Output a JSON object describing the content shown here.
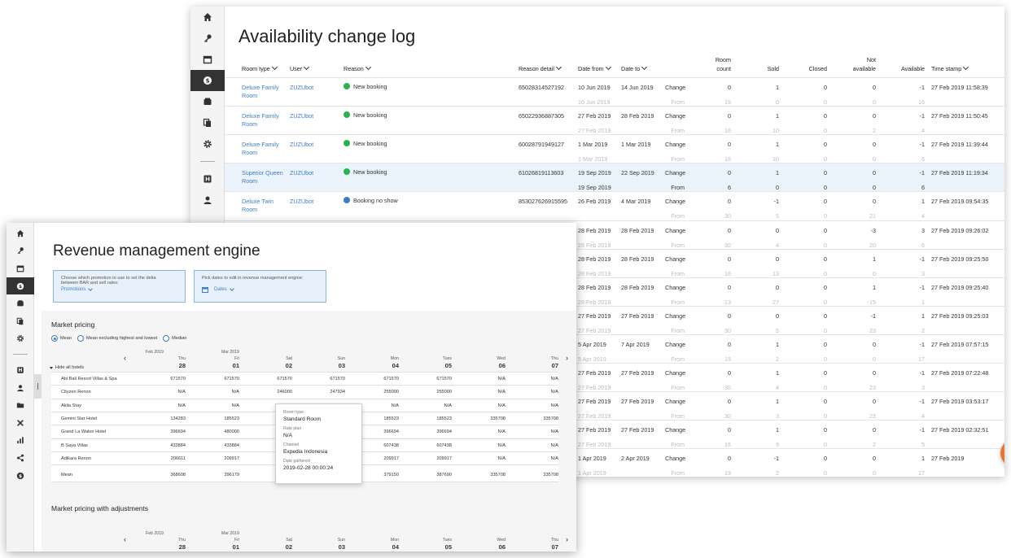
{
  "back": {
    "title": "Availability change log",
    "headers": {
      "room_type": "Room type",
      "user": "User",
      "reason": "Reason",
      "reason_detail": "Reason detail",
      "date_from": "Date from",
      "date_to": "Date to",
      "room_count_1": "Room",
      "room_count_2": "count",
      "sold": "Sold",
      "closed": "Closed",
      "not_available_1": "Not",
      "not_available_2": "available",
      "available": "Available",
      "timestamp": "Time stamp"
    },
    "colors": {
      "green": "#2ab24e",
      "blue": "#3b7ec8"
    },
    "rows": [
      {
        "room": "Deluxe Family",
        "room2": "Room",
        "user": "ZUZUbot",
        "reason": "New booking",
        "dot": "green",
        "detail": "65028314527192",
        "from": "10 Jun 2019",
        "to": "14 Jun 2019",
        "change": "Change",
        "rc": "0",
        "sold": "1",
        "closed": "0",
        "na": "0",
        "avail": "-1",
        "ts": "27 Feb 2019 11:58:39",
        "sub_from": "10 Jun 2019",
        "sub_lbl": "From",
        "s_rc": "16",
        "s_sold": "0",
        "s_closed": "0",
        "s_na": "0",
        "s_avail": "16"
      },
      {
        "room": "Deluxe Family",
        "room2": "Room",
        "user": "ZUZUbot",
        "reason": "New booking",
        "dot": "green",
        "detail": "65022936887305",
        "from": "27 Feb 2019",
        "to": "28 Feb 2019",
        "change": "Change",
        "rc": "0",
        "sold": "1",
        "closed": "0",
        "na": "0",
        "avail": "-1",
        "ts": "27 Feb 2019 11:50:45",
        "sub_from": "27 Feb 2019",
        "sub_lbl": "From",
        "s_rc": "16",
        "s_sold": "10",
        "s_closed": "0",
        "s_na": "2",
        "s_avail": "4"
      },
      {
        "room": "Deluxe Family",
        "room2": "Room",
        "user": "ZUZUbot",
        "reason": "New booking",
        "dot": "green",
        "detail": "60028791949127",
        "from": "1 Mar 2019",
        "to": "1 Mar 2019",
        "change": "Change",
        "rc": "0",
        "sold": "1",
        "closed": "0",
        "na": "0",
        "avail": "-1",
        "ts": "27 Feb 2019 11:39:44",
        "sub_from": "1 Mar 2019",
        "sub_lbl": "From",
        "s_rc": "16",
        "s_sold": "10",
        "s_closed": "0",
        "s_na": "0",
        "s_avail": "6"
      },
      {
        "room": "Superior Queen",
        "room2": "Room",
        "user": "ZUZUbot",
        "reason": "New booking",
        "dot": "green",
        "detail": "61026819113603",
        "from": "19 Sep 2019",
        "to": "22 Sep 2019",
        "change": "Change",
        "rc": "0",
        "sold": "1",
        "closed": "0",
        "na": "0",
        "avail": "-1",
        "ts": "27 Feb 2019 11:19:34",
        "sub_from": "19 Sep 2019",
        "sub_lbl": "From",
        "s_rc": "6",
        "s_sold": "0",
        "s_closed": "0",
        "s_na": "0",
        "s_avail": "6"
      },
      {
        "room": "Deluxe Twin",
        "room2": "Room",
        "user": "ZUZUbot",
        "reason": "Booking no show",
        "dot": "blue",
        "detail": "853027626915595",
        "from": "26 Feb 2019",
        "to": "4 Mar 2019",
        "change": "Change",
        "rc": "0",
        "sold": "-1",
        "closed": "0",
        "na": "0",
        "avail": "1",
        "ts": "27 Feb 2019 09:54:35",
        "sub_from": "",
        "sub_lbl": "From",
        "s_rc": "30",
        "s_sold": "5",
        "s_closed": "0",
        "s_na": "21",
        "s_avail": "4"
      },
      {
        "room": "",
        "room2": "",
        "user": "",
        "reason": "",
        "dot": "",
        "detail": "",
        "from": "28 Feb 2019",
        "to": "28 Feb 2019",
        "change": "Change",
        "rc": "0",
        "sold": "0",
        "closed": "0",
        "na": "-3",
        "avail": "3",
        "ts": "27 Feb 2019 09:26:02",
        "sub_from": "28 Feb 2019",
        "sub_lbl": "From",
        "s_rc": "30",
        "s_sold": "4",
        "s_closed": "0",
        "s_na": "20",
        "s_avail": "6"
      },
      {
        "room": "",
        "room2": "",
        "user": "",
        "reason": "",
        "dot": "",
        "detail": "",
        "from": "28 Feb 2019",
        "to": "28 Feb 2019",
        "change": "Change",
        "rc": "0",
        "sold": "0",
        "closed": "0",
        "na": "1",
        "avail": "-1",
        "ts": "27 Feb 2019 09:25:50",
        "sub_from": "28 Feb 2019",
        "sub_lbl": "From",
        "s_rc": "16",
        "s_sold": "13",
        "s_closed": "0",
        "s_na": "0",
        "s_avail": "3"
      },
      {
        "room": "",
        "room2": "",
        "user": "",
        "reason": "",
        "dot": "",
        "detail": "",
        "from": "28 Feb 2019",
        "to": "28 Feb 2019",
        "change": "Change",
        "rc": "0",
        "sold": "0",
        "closed": "0",
        "na": "1",
        "avail": "-1",
        "ts": "27 Feb 2019 09:25:40",
        "sub_from": "28 Feb 2019",
        "sub_lbl": "From",
        "s_rc": "13",
        "s_sold": "27",
        "s_closed": "0",
        "s_na": "-15",
        "s_avail": "1"
      },
      {
        "room": "",
        "room2": "",
        "user": "",
        "reason": "",
        "dot": "",
        "detail": "",
        "from": "27 Feb 2019",
        "to": "27 Feb 2019",
        "change": "Change",
        "rc": "0",
        "sold": "0",
        "closed": "0",
        "na": "-1",
        "avail": "1",
        "ts": "27 Feb 2019 09:25:03",
        "sub_from": "27 Feb 2019",
        "sub_lbl": "From",
        "s_rc": "30",
        "s_sold": "5",
        "s_closed": "0",
        "s_na": "23",
        "s_avail": "2"
      },
      {
        "room": "",
        "room2": "",
        "user": "",
        "reason": "",
        "dot": "",
        "detail": "",
        "from": "5 Apr 2019",
        "to": "7 Apr 2019",
        "change": "Change",
        "rc": "0",
        "sold": "1",
        "closed": "0",
        "na": "0",
        "avail": "-1",
        "ts": "27 Feb 2019 07:57:15",
        "sub_from": "5 Apr 2019",
        "sub_lbl": "From",
        "s_rc": "19",
        "s_sold": "2",
        "s_closed": "0",
        "s_na": "0",
        "s_avail": "17"
      },
      {
        "room": "",
        "room2": "",
        "user": "",
        "reason": "",
        "dot": "",
        "detail": "",
        "from": "27 Feb 2019",
        "to": "27 Feb 2019",
        "change": "Change",
        "rc": "0",
        "sold": "1",
        "closed": "0",
        "na": "0",
        "avail": "-1",
        "ts": "27 Feb 2019 07:22:48",
        "sub_from": "27 Feb 2019",
        "sub_lbl": "From",
        "s_rc": "30",
        "s_sold": "4",
        "s_closed": "0",
        "s_na": "23",
        "s_avail": "3"
      },
      {
        "room": "",
        "room2": "",
        "user": "",
        "reason": "",
        "dot": "",
        "detail": "",
        "from": "27 Feb 2019",
        "to": "27 Feb 2019",
        "change": "Change",
        "rc": "0",
        "sold": "1",
        "closed": "0",
        "na": "0",
        "avail": "-1",
        "ts": "27 Feb 2019 03:53:17",
        "sub_from": "27 Feb 2019",
        "sub_lbl": "From",
        "s_rc": "30",
        "s_sold": "3",
        "s_closed": "0",
        "s_na": "23",
        "s_avail": "4"
      },
      {
        "room": "",
        "room2": "",
        "user": "",
        "reason": "",
        "dot": "",
        "detail": "",
        "from": "27 Feb 2019",
        "to": "27 Feb 2019",
        "change": "Change",
        "rc": "0",
        "sold": "1",
        "closed": "0",
        "na": "0",
        "avail": "-1",
        "ts": "27 Feb 2019 02:32:51",
        "sub_from": "27 Feb 2019",
        "sub_lbl": "From",
        "s_rc": "16",
        "s_sold": "9",
        "s_closed": "0",
        "s_na": "2",
        "s_avail": "5"
      },
      {
        "room": "",
        "room2": "",
        "user": "",
        "reason": "",
        "dot": "",
        "detail": "",
        "from": "1 Apr 2019",
        "to": "2 Apr 2019",
        "change": "Change",
        "rc": "0",
        "sold": "-1",
        "closed": "0",
        "na": "0",
        "avail": "1",
        "ts": "27 Feb 2019",
        "sub_from": "1 Apr 2019",
        "sub_lbl": "From",
        "s_rc": "19",
        "s_sold": "2",
        "s_closed": "0",
        "s_na": "0",
        "s_avail": "17"
      }
    ]
  },
  "front": {
    "title": "Revenue management engine",
    "promo_box": {
      "text1": "Choose which promotion to use to set the delta",
      "text2": "between BAR and sell rates:",
      "value": "Promotions"
    },
    "dates_box": {
      "text": "Pick dates to edit in revenue management engine:",
      "value": "Dates"
    },
    "section1": "Market pricing",
    "section2": "Market pricing with adjustments",
    "radios": [
      "Mean",
      "Mean excluding highest and lowest",
      "Median"
    ],
    "months": [
      "Feb 2019",
      "Mar 2019"
    ],
    "days": [
      {
        "wd": "Thu",
        "d": "28"
      },
      {
        "wd": "Fri",
        "d": "01"
      },
      {
        "wd": "Sat",
        "d": "02"
      },
      {
        "wd": "Sun",
        "d": "03"
      },
      {
        "wd": "Mon",
        "d": "04"
      },
      {
        "wd": "Tues",
        "d": "05"
      },
      {
        "wd": "Wed",
        "d": "06"
      },
      {
        "wd": "Thu",
        "d": "07"
      }
    ],
    "hide_all": "Hide all hotels",
    "hotels": [
      {
        "name": "Abi Bali Resort Villas & Spa",
        "v": [
          "671570",
          "671570",
          "671570",
          "671570",
          "671570",
          "671570",
          "N/A",
          "N/A"
        ]
      },
      {
        "name": "Cityzen Renon",
        "v": [
          "N/A",
          "N/A",
          "246000",
          "247934",
          "255000",
          "255000",
          "N/A",
          "N/A"
        ]
      },
      {
        "name": "Akila Stay",
        "v": [
          "N/A",
          "N/A",
          "",
          "N/A",
          "N/A",
          "N/A",
          "N/A",
          "N/A"
        ]
      },
      {
        "name": "Gemini Star Hotel",
        "v": [
          "134283",
          "185523",
          "",
          "185523",
          "185523",
          "185523",
          "335708",
          "335708"
        ]
      },
      {
        "name": "Grand La Walon Hotel",
        "v": [
          "396694",
          "480000",
          "",
          "396694",
          "396694",
          "396694",
          "N/A",
          "N/A"
        ]
      },
      {
        "name": "B Saya Villas",
        "v": [
          "433884",
          "433884",
          "",
          "209917",
          "607438",
          "607438",
          "N/A",
          "N/A"
        ]
      },
      {
        "name": "Adikara Renon",
        "v": [
          "206611",
          "209917",
          "",
          "209917",
          "209917",
          "209917",
          "N/A",
          "N/A"
        ]
      }
    ],
    "mean": {
      "name": "Mean",
      "v": [
        "368608",
        "396179",
        "",
        "357587",
        "379150",
        "387690",
        "335708",
        "335708"
      ]
    },
    "tooltip": {
      "l1": "Room type",
      "v1": "Standard Room",
      "l2": "Rate plan",
      "v2": "N/A",
      "l3": "Channel",
      "v3": "Expedia Indonesia",
      "l4": "Date gathered",
      "v4": "2019-02-28 00:00:24"
    }
  }
}
